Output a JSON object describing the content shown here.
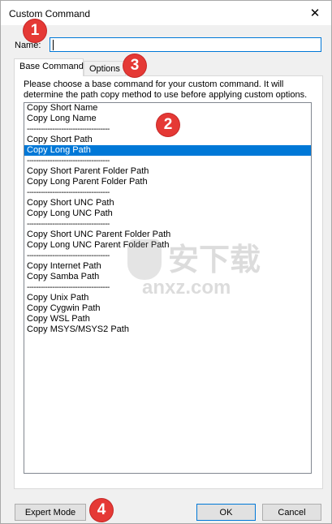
{
  "window": {
    "title": "Custom Command",
    "close_glyph": "✕"
  },
  "name_field": {
    "label": "Name:",
    "value": ""
  },
  "tabs": [
    {
      "label": "Base Command",
      "active": true
    },
    {
      "label": "Options",
      "active": false
    }
  ],
  "base_command": {
    "description": "Please choose a base command for your custom command. It will determine the path copy method to use before applying custom options.",
    "items": [
      {
        "label": "Copy Short Name",
        "type": "item"
      },
      {
        "label": "Copy Long Name",
        "type": "item"
      },
      {
        "label": "------------------------------------",
        "type": "separator"
      },
      {
        "label": "Copy Short Path",
        "type": "item"
      },
      {
        "label": "Copy Long Path",
        "type": "item",
        "selected": true
      },
      {
        "label": "------------------------------------",
        "type": "separator"
      },
      {
        "label": "Copy Short Parent Folder Path",
        "type": "item"
      },
      {
        "label": "Copy Long Parent Folder Path",
        "type": "item"
      },
      {
        "label": "------------------------------------",
        "type": "separator"
      },
      {
        "label": "Copy Short UNC Path",
        "type": "item"
      },
      {
        "label": "Copy Long UNC Path",
        "type": "item"
      },
      {
        "label": "------------------------------------",
        "type": "separator"
      },
      {
        "label": "Copy Short UNC Parent Folder Path",
        "type": "item"
      },
      {
        "label": "Copy Long UNC Parent Folder Path",
        "type": "item"
      },
      {
        "label": "------------------------------------",
        "type": "separator"
      },
      {
        "label": "Copy Internet Path",
        "type": "item"
      },
      {
        "label": "Copy Samba Path",
        "type": "item"
      },
      {
        "label": "------------------------------------",
        "type": "separator"
      },
      {
        "label": "Copy Unix Path",
        "type": "item"
      },
      {
        "label": "Copy Cygwin Path",
        "type": "item"
      },
      {
        "label": "Copy WSL Path",
        "type": "item"
      },
      {
        "label": "Copy MSYS/MSYS2 Path",
        "type": "item"
      }
    ]
  },
  "buttons": {
    "expert_mode": "Expert Mode",
    "ok": "OK",
    "cancel": "Cancel"
  },
  "annotations": [
    "1",
    "2",
    "3",
    "4"
  ],
  "watermark": {
    "cn": "安下载",
    "en": "anxz.com"
  },
  "colors": {
    "selection": "#0078d7",
    "badge": "#e53935"
  }
}
